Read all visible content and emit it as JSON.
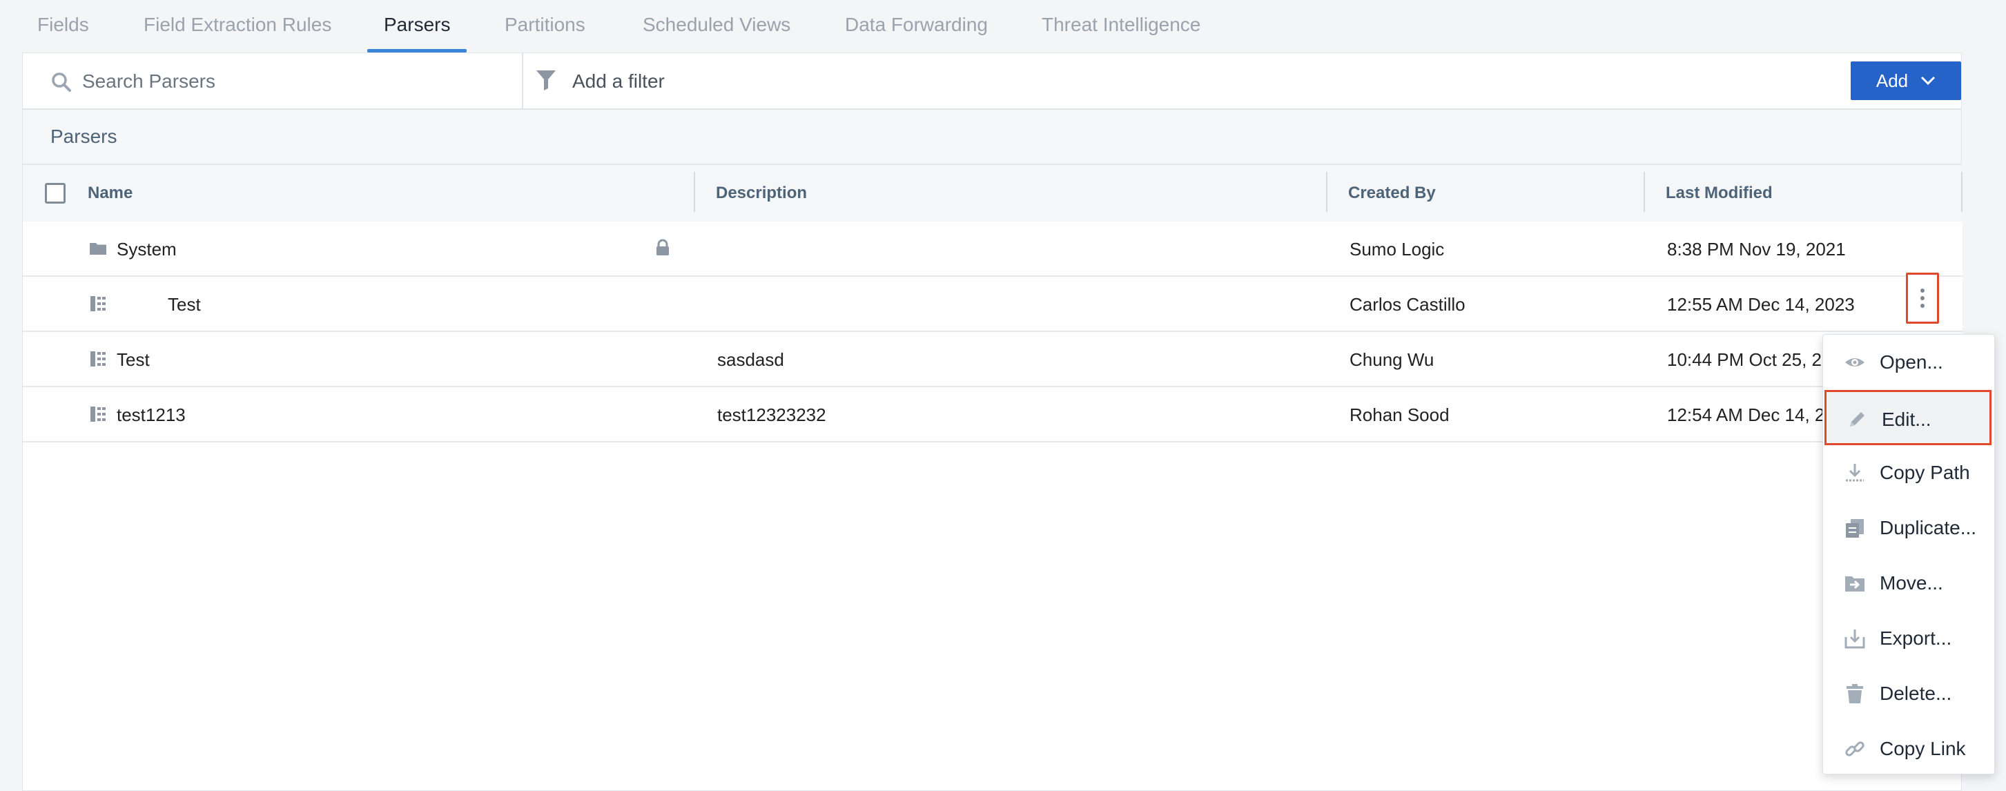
{
  "tabs": [
    {
      "label": "Fields"
    },
    {
      "label": "Field Extraction Rules"
    },
    {
      "label": "Parsers"
    },
    {
      "label": "Partitions"
    },
    {
      "label": "Scheduled Views"
    },
    {
      "label": "Data Forwarding"
    },
    {
      "label": "Threat Intelligence"
    }
  ],
  "active_tab": "Parsers",
  "toolbar": {
    "search_placeholder": "Search Parsers",
    "filter_label": "Add a filter",
    "add_label": "Add"
  },
  "section_title": "Parsers",
  "table": {
    "columns": [
      "Name",
      "Description",
      "Created By",
      "Last Modified"
    ],
    "rows": [
      {
        "icon": "folder-icon",
        "name": "System",
        "locked": true,
        "description": "",
        "created_by": "Sumo Logic",
        "last_modified": "8:38 PM Nov 19, 2021"
      },
      {
        "icon": "parser-icon",
        "name": "Test",
        "locked": false,
        "description": "",
        "created_by": "Carlos Castillo",
        "last_modified": "12:55 AM Dec 14, 2023"
      },
      {
        "icon": "parser-icon",
        "name": "Test",
        "locked": false,
        "description": "sasdasd",
        "created_by": "Chung Wu",
        "last_modified": "10:44 PM Oct 25, 2023"
      },
      {
        "icon": "parser-icon",
        "name": "test1213",
        "locked": false,
        "description": "test12323232",
        "created_by": "Rohan Sood",
        "last_modified": "12:54 AM Dec 14, 2023"
      }
    ]
  },
  "context_menu": {
    "items": [
      {
        "label": "Open...",
        "icon": "eye-icon"
      },
      {
        "label": "Edit...",
        "icon": "pencil-icon"
      },
      {
        "label": "Copy Path",
        "icon": "copy-path-icon"
      },
      {
        "label": "Duplicate...",
        "icon": "duplicate-icon"
      },
      {
        "label": "Move...",
        "icon": "move-folder-icon"
      },
      {
        "label": "Export...",
        "icon": "export-icon"
      },
      {
        "label": "Delete...",
        "icon": "trash-icon"
      },
      {
        "label": "Copy Link",
        "icon": "link-icon"
      }
    ],
    "highlighted": "Edit..."
  },
  "colors": {
    "accent": "#2563c8",
    "tab_indicator": "#3a86d6",
    "highlight_border": "#e0492b",
    "icon_gray": "#9aa5b1"
  }
}
